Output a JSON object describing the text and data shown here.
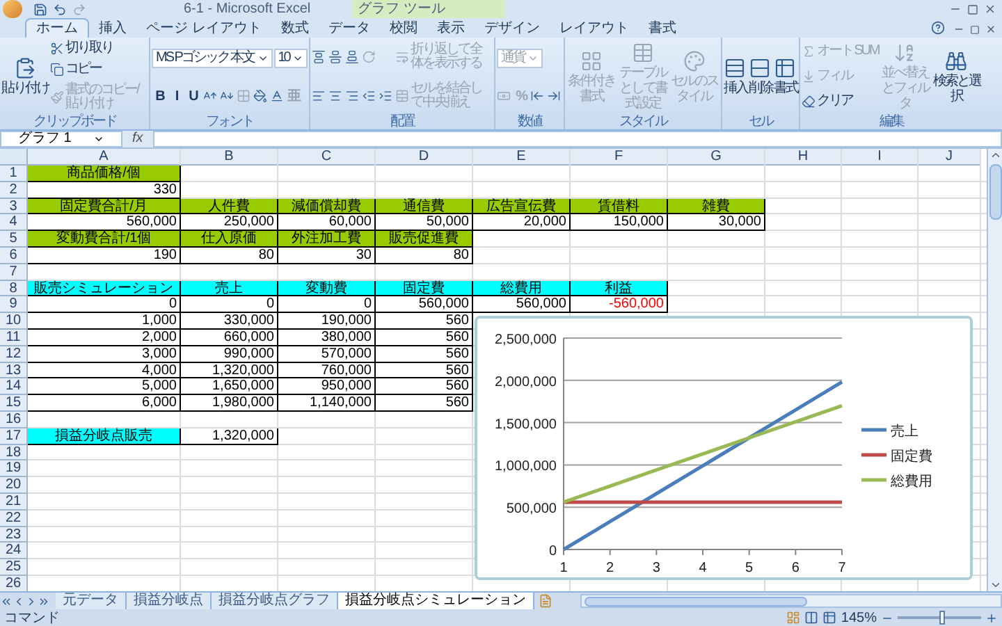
{
  "window": {
    "title": "6-1 - Microsoft Excel",
    "context_label": "グラフ ツール"
  },
  "ribbon_tabs": [
    {
      "label": "ホーム",
      "selected": true
    },
    {
      "label": "挿入",
      "selected": false
    },
    {
      "label": "ページ レイアウト",
      "selected": false
    },
    {
      "label": "数式",
      "selected": false
    },
    {
      "label": "データ",
      "selected": false
    },
    {
      "label": "校閲",
      "selected": false
    },
    {
      "label": "表示",
      "selected": false
    },
    {
      "label": "デザイン",
      "selected": false
    },
    {
      "label": "レイアウト",
      "selected": false
    },
    {
      "label": "書式",
      "selected": false
    }
  ],
  "ribbon": {
    "groups": [
      {
        "name": "クリップボード",
        "columns": [
          [
            [
              {
                "kind": "large",
                "label": "貼り付け",
                "disabled": false
              }
            ]
          ],
          [
            [
              {
                "kind": "small",
                "label": "切り取り",
                "disabled": false
              }
            ],
            [
              {
                "kind": "small",
                "label": "コピー",
                "disabled": false
              }
            ],
            [
              {
                "kind": "small",
                "label": "書式のコピー/貼り付け",
                "disabled": true
              }
            ]
          ]
        ]
      },
      {
        "name": "フォント",
        "columns": [
          [
            [
              {
                "kind": "dropdown",
                "label": "MS Pゴシック 本文",
                "disabled": false
              },
              {
                "kind": "dropdown",
                "label": "10",
                "disabled": false
              }
            ],
            [
              {
                "kind": "toggle",
                "label": "B",
                "disabled": false
              },
              {
                "kind": "toggle",
                "label": "I",
                "disabled": false
              },
              {
                "kind": "toggle",
                "label": "U",
                "disabled": false
              },
              {
                "kind": "icon",
                "disabled": false
              },
              {
                "kind": "icon",
                "disabled": false
              },
              {
                "kind": "icon",
                "disabled": true
              },
              {
                "kind": "icon",
                "disabled": false
              },
              {
                "kind": "icon",
                "disabled": false
              },
              {
                "kind": "toggle",
                "label": "亜",
                "disabled": true
              }
            ]
          ]
        ]
      },
      {
        "name": "配置",
        "columns": [
          [
            [
              {
                "kind": "icon",
                "disabled": false
              },
              {
                "kind": "icon",
                "disabled": false
              },
              {
                "kind": "icon",
                "disabled": false
              },
              {
                "kind": "icon",
                "disabled": true
              }
            ],
            [
              {
                "kind": "icon",
                "disabled": false
              },
              {
                "kind": "icon",
                "disabled": false
              },
              {
                "kind": "icon",
                "disabled": false
              },
              {
                "kind": "icon",
                "disabled": false
              },
              {
                "kind": "icon",
                "disabled": false
              }
            ]
          ],
          [
            [
              {
                "kind": "small",
                "label": "折り返して全体を表示する",
                "disabled": true
              }
            ],
            [
              {
                "kind": "small",
                "label": "セルを結合して中央揃え",
                "disabled": true
              }
            ]
          ]
        ]
      },
      {
        "name": "数値",
        "columns": [
          [
            [
              {
                "kind": "dropdown",
                "label": "通貨",
                "disabled": true
              }
            ],
            [
              {
                "kind": "icon",
                "disabled": true
              },
              {
                "kind": "toggle",
                "label": "%",
                "disabled": true
              },
              {
                "kind": "icon",
                "disabled": false
              },
              {
                "kind": "icon",
                "disabled": false
              }
            ]
          ]
        ]
      },
      {
        "name": "スタイル",
        "columns": [
          [
            [
              {
                "kind": "large",
                "label": "条件付き書式",
                "disabled": true
              }
            ]
          ],
          [
            [
              {
                "kind": "large",
                "label": "テーブルとして書式設定",
                "disabled": true
              }
            ]
          ],
          [
            [
              {
                "kind": "large",
                "label": "セルのスタイル",
                "disabled": true
              }
            ]
          ]
        ]
      },
      {
        "name": "セル",
        "columns": [
          [
            [
              {
                "kind": "large",
                "label": "挿入",
                "disabled": false
              }
            ]
          ],
          [
            [
              {
                "kind": "large",
                "label": "削除",
                "disabled": false
              }
            ]
          ],
          [
            [
              {
                "kind": "large",
                "label": "書式",
                "disabled": false
              }
            ]
          ]
        ]
      },
      {
        "name": "編集",
        "columns": [
          [
            [
              {
                "kind": "small",
                "label": "オート SUM",
                "disabled": true
              }
            ],
            [
              {
                "kind": "small",
                "label": "フィル",
                "disabled": true
              }
            ],
            [
              {
                "kind": "small",
                "label": "クリア",
                "disabled": false
              }
            ]
          ],
          [
            [
              {
                "kind": "large",
                "label": "並べ替えとフィルタ",
                "disabled": true
              }
            ]
          ],
          [
            [
              {
                "kind": "large",
                "label": "検索と選択",
                "disabled": false
              }
            ]
          ]
        ]
      }
    ]
  },
  "formula_bar": {
    "name_box": "グラフ 1",
    "function_label": "fx"
  },
  "sheet": {
    "columns": [
      "A",
      "B",
      "C",
      "D",
      "E",
      "F",
      "G",
      "H",
      "I",
      "J"
    ],
    "rows": [
      {
        "number": "1",
        "cells": [
          {
            "kind": "green_header",
            "text": "商品価格/個"
          }
        ]
      },
      {
        "number": "2",
        "cells": [
          {
            "kind": "number",
            "text": "330"
          }
        ]
      },
      {
        "number": "3",
        "cells": [
          {
            "kind": "green_header",
            "text": "固定費合計/月"
          },
          {
            "kind": "green_header",
            "text": "人件費"
          },
          {
            "kind": "green_header",
            "text": "減価償却費"
          },
          {
            "kind": "green_header",
            "text": "通信費"
          },
          {
            "kind": "green_header",
            "text": "広告宣伝費"
          },
          {
            "kind": "green_header",
            "text": "賃借料"
          },
          {
            "kind": "green_header",
            "text": "雑費"
          }
        ]
      },
      {
        "number": "4",
        "cells": [
          {
            "kind": "number",
            "text": "560,000"
          },
          {
            "kind": "number",
            "text": "250,000"
          },
          {
            "kind": "number",
            "text": "60,000"
          },
          {
            "kind": "number",
            "text": "50,000"
          },
          {
            "kind": "number",
            "text": "20,000"
          },
          {
            "kind": "number",
            "text": "150,000"
          },
          {
            "kind": "number",
            "text": "30,000"
          }
        ]
      },
      {
        "number": "5",
        "cells": [
          {
            "kind": "green_header",
            "text": "変動費合計/1個"
          },
          {
            "kind": "green_header",
            "text": "仕入原価"
          },
          {
            "kind": "green_header",
            "text": "外注加工費"
          },
          {
            "kind": "green_header",
            "text": "販売促進費"
          }
        ]
      },
      {
        "number": "6",
        "cells": [
          {
            "kind": "number",
            "text": "190"
          },
          {
            "kind": "number",
            "text": "80"
          },
          {
            "kind": "number",
            "text": "30"
          },
          {
            "kind": "number",
            "text": "80"
          }
        ]
      },
      {
        "number": "7"
      },
      {
        "number": "8",
        "cells": [
          {
            "kind": "cyan_header",
            "text": "販売シミュレーション"
          },
          {
            "kind": "cyan_header",
            "text": "売上"
          },
          {
            "kind": "cyan_header",
            "text": "変動費"
          },
          {
            "kind": "cyan_header",
            "text": "固定費"
          },
          {
            "kind": "cyan_header",
            "text": "総費用"
          },
          {
            "kind": "cyan_header",
            "text": "利益"
          }
        ]
      },
      {
        "number": "9",
        "cells": [
          {
            "kind": "number",
            "text": "0"
          },
          {
            "kind": "number",
            "text": "0"
          },
          {
            "kind": "number",
            "text": "0"
          },
          {
            "kind": "number",
            "text": "560,000"
          },
          {
            "kind": "number",
            "text": "560,000"
          },
          {
            "kind": "negative_number",
            "text": "-560,000"
          }
        ]
      },
      {
        "number": "10",
        "cells": [
          {
            "kind": "number",
            "text": "1,000"
          },
          {
            "kind": "number",
            "text": "330,000"
          },
          {
            "kind": "number",
            "text": "190,000"
          },
          {
            "kind": "number",
            "text": "560"
          }
        ]
      },
      {
        "number": "11",
        "cells": [
          {
            "kind": "number",
            "text": "2,000"
          },
          {
            "kind": "number",
            "text": "660,000"
          },
          {
            "kind": "number",
            "text": "380,000"
          },
          {
            "kind": "number",
            "text": "560"
          }
        ]
      },
      {
        "number": "12",
        "cells": [
          {
            "kind": "number",
            "text": "3,000"
          },
          {
            "kind": "number",
            "text": "990,000"
          },
          {
            "kind": "number",
            "text": "570,000"
          },
          {
            "kind": "number",
            "text": "560"
          }
        ]
      },
      {
        "number": "13",
        "cells": [
          {
            "kind": "number",
            "text": "4,000"
          },
          {
            "kind": "number",
            "text": "1,320,000"
          },
          {
            "kind": "number",
            "text": "760,000"
          },
          {
            "kind": "number",
            "text": "560"
          }
        ]
      },
      {
        "number": "14",
        "cells": [
          {
            "kind": "number",
            "text": "5,000"
          },
          {
            "kind": "number",
            "text": "1,650,000"
          },
          {
            "kind": "number",
            "text": "950,000"
          },
          {
            "kind": "number",
            "text": "560"
          }
        ]
      },
      {
        "number": "15",
        "cells": [
          {
            "kind": "number",
            "text": "6,000"
          },
          {
            "kind": "number",
            "text": "1,980,000"
          },
          {
            "kind": "number",
            "text": "1,140,000"
          },
          {
            "kind": "number",
            "text": "560"
          }
        ]
      },
      {
        "number": "16"
      },
      {
        "number": "17",
        "cells": [
          {
            "kind": "cyan_header",
            "text": "損益分岐点販売"
          },
          {
            "kind": "number",
            "text": "1,320,000"
          }
        ]
      },
      {
        "number": "18"
      },
      {
        "number": "19"
      },
      {
        "number": "20"
      },
      {
        "number": "21"
      },
      {
        "number": "22"
      },
      {
        "number": "23"
      },
      {
        "number": "24"
      },
      {
        "number": "25"
      },
      {
        "number": "26"
      }
    ]
  },
  "chart": {
    "chart_data": {
      "type": "line",
      "categories": [
        "1",
        "2",
        "3",
        "4",
        "5",
        "6",
        "7"
      ],
      "series": [
        {
          "name": "売上",
          "color": "#4a7ebb",
          "values": [
            0,
            330000,
            660000,
            990000,
            1320000,
            1650000,
            1980000
          ]
        },
        {
          "name": "固定費",
          "color": "#be4b48",
          "values": [
            560000,
            560000,
            560000,
            560000,
            560000,
            560000,
            560000
          ]
        },
        {
          "name": "総費用",
          "color": "#98b954",
          "values": [
            560000,
            750000,
            940000,
            1130000,
            1320000,
            1510000,
            1700000
          ]
        }
      ],
      "ylim": [
        0,
        2500000
      ],
      "grid": true,
      "legend": true,
      "yticks": [
        {
          "value": 0,
          "label": "0"
        },
        {
          "value": 500000,
          "label": "500,000"
        },
        {
          "value": 1000000,
          "label": "1,000,000"
        },
        {
          "value": 1500000,
          "label": "1,500,000"
        },
        {
          "value": 2000000,
          "label": "2,000,000"
        },
        {
          "value": 2500000,
          "label": "2,500,000"
        }
      ]
    }
  },
  "sheet_tabs": [
    {
      "label": "元データ",
      "selected": false
    },
    {
      "label": "損益分岐点",
      "selected": false
    },
    {
      "label": "損益分岐点グラフ",
      "selected": false
    },
    {
      "label": "損益分岐点シミュレーション",
      "selected": true
    }
  ],
  "status_bar": {
    "mode": "コマンド",
    "zoom": "145%",
    "zoom_slider": {
      "level": 0.53
    }
  }
}
